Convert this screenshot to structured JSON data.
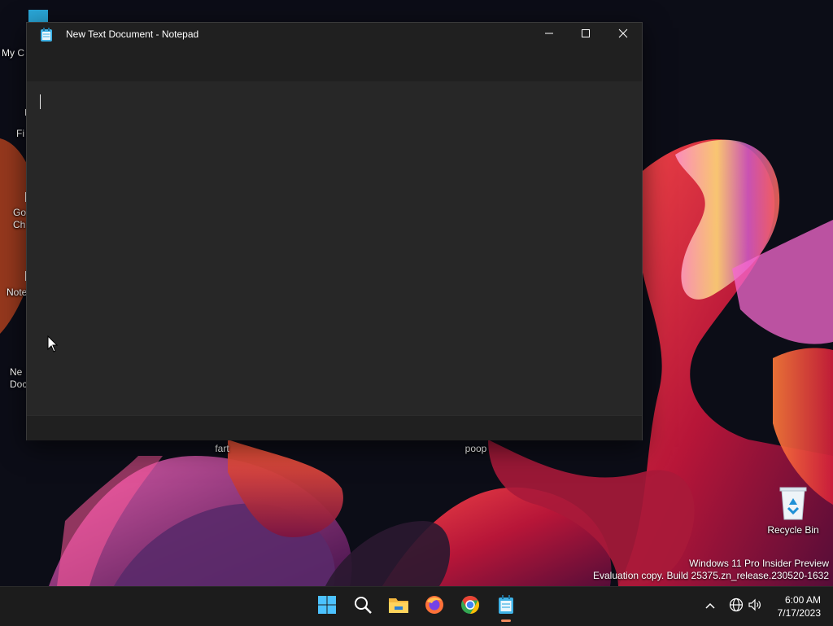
{
  "window": {
    "title": "New Text Document - Notepad",
    "app_icon": "notepad-icon",
    "caption_buttons": [
      "minimize-icon",
      "maximize-icon",
      "close-icon"
    ],
    "editor_text": ""
  },
  "desktop": {
    "icons": [
      {
        "label": "My C",
        "icon": "computer-icon"
      },
      {
        "label": "Fi",
        "icon": "firefox-icon"
      },
      {
        "label": "Go\nCh",
        "icon": "chrome-icon"
      },
      {
        "label": "Note",
        "icon": "notepad-plus-icon"
      },
      {
        "label": "Ne\nDoc",
        "icon": "text-document-icon"
      },
      {
        "label": "fart",
        "icon": "folder-icon"
      },
      {
        "label": "poop",
        "icon": "folder-icon"
      },
      {
        "label": "Recycle Bin",
        "icon": "recycle-bin-icon"
      }
    ],
    "watermark": {
      "line1": "Windows 11 Pro Insider Preview",
      "line2": "Evaluation copy. Build 25375.zn_release.230520-1632"
    }
  },
  "taskbar": {
    "pinned": [
      "windows-start-icon",
      "search-icon",
      "file-explorer-icon",
      "firefox-icon",
      "chrome-icon",
      "notepad-icon"
    ],
    "active_app": "notepad-icon",
    "tray": [
      "chevron-up-icon",
      "network-globe-icon",
      "volume-icon"
    ],
    "clock": {
      "time": "6:00 AM",
      "date": "7/17/2023"
    }
  },
  "colors": {
    "window_bg": "#202020",
    "editor_bg": "#272727",
    "taskbar_bg": "#1c1c1c",
    "accent": "#f08a5d"
  }
}
